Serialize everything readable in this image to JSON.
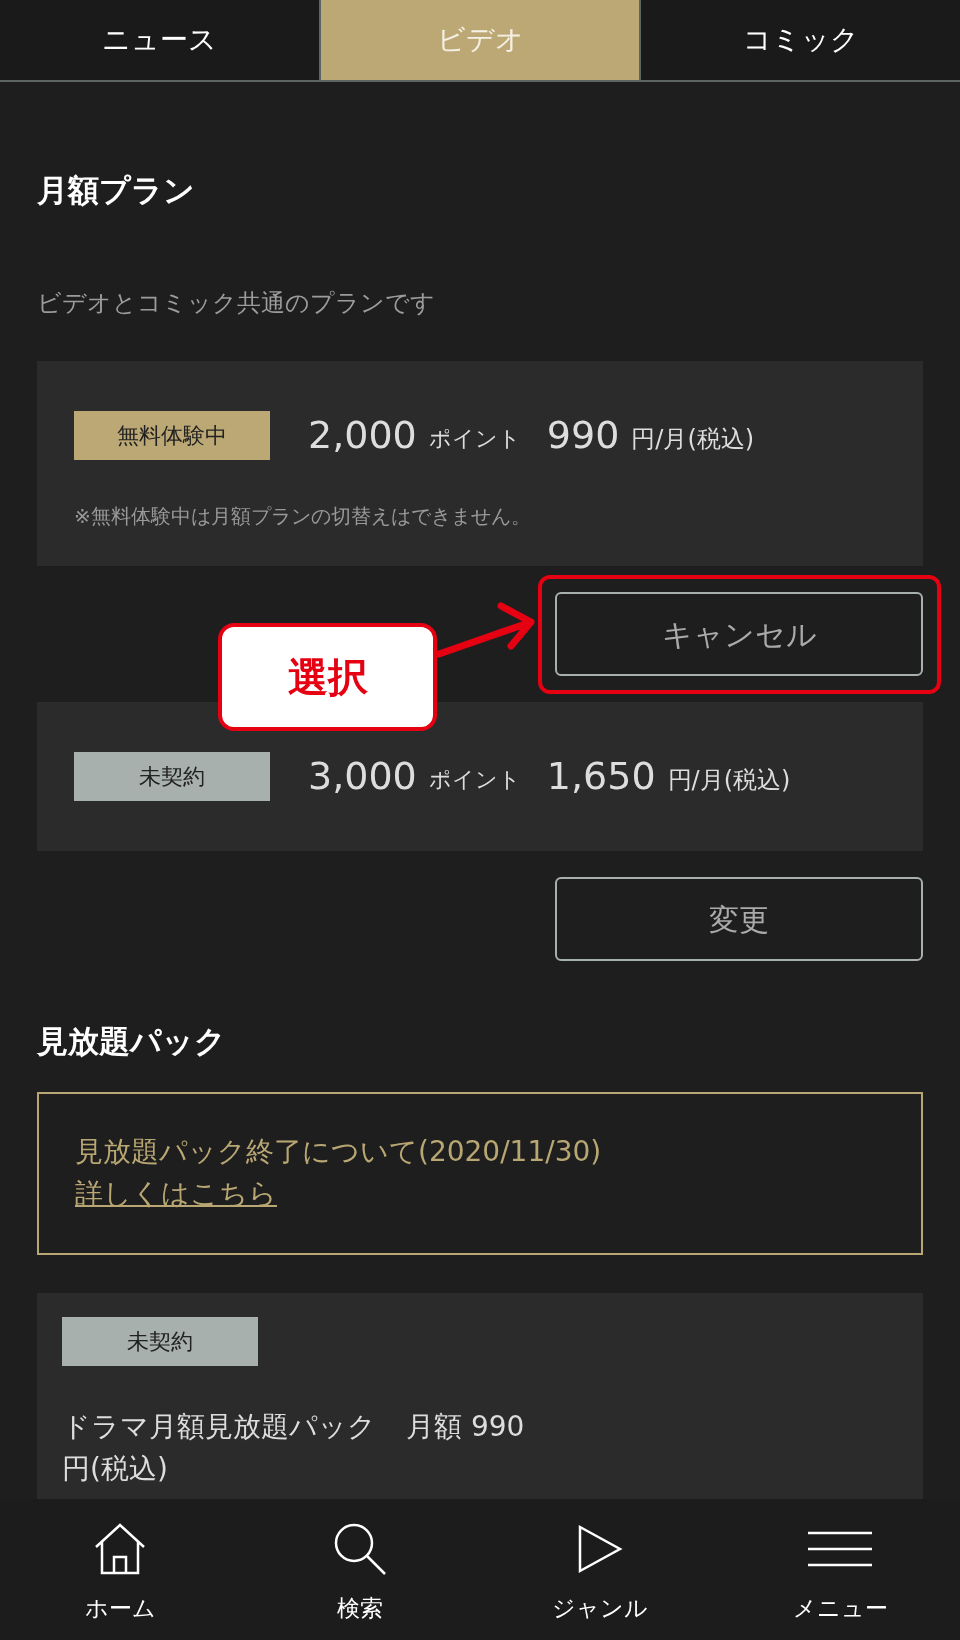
{
  "tabs": [
    {
      "label": "ニュース",
      "selected": false
    },
    {
      "label": "ビデオ",
      "selected": true
    },
    {
      "label": "コミック",
      "selected": false
    }
  ],
  "monthly_plan": {
    "title": "月額プラン",
    "subtitle": "ビデオとコミック共通のプランです",
    "plans": [
      {
        "status": "無料体験中",
        "kind": "trial",
        "points": "2,000",
        "points_unit": "ポイント",
        "price": "990",
        "price_unit": "円/月(税込)",
        "note": "※無料体験中は月額プランの切替えはできません。",
        "button": "キャンセル",
        "highlighted": true
      },
      {
        "status": "未契約",
        "kind": "none",
        "points": "3,000",
        "points_unit": "ポイント",
        "price": "1,650",
        "price_unit": "円/月(税込)",
        "button": "変更",
        "highlighted": false
      }
    ]
  },
  "annotation": {
    "label": "選択"
  },
  "unlimited_pack": {
    "title": "見放題パック",
    "notice": {
      "text": "見放題パック終了について(2020/11/30)",
      "link": "詳しくはこちら"
    },
    "packs": [
      {
        "status": "未契約",
        "kind": "none",
        "name": "ドラマ月額見放題パック",
        "price_label": "月額",
        "price": "990",
        "price_unit": "円(税込)"
      }
    ]
  },
  "bottom_nav": [
    {
      "label": "ホーム",
      "kind": "home"
    },
    {
      "label": "検索",
      "kind": "search"
    },
    {
      "label": "ジャンル",
      "kind": "play"
    },
    {
      "label": "メニュー",
      "kind": "menu"
    }
  ]
}
